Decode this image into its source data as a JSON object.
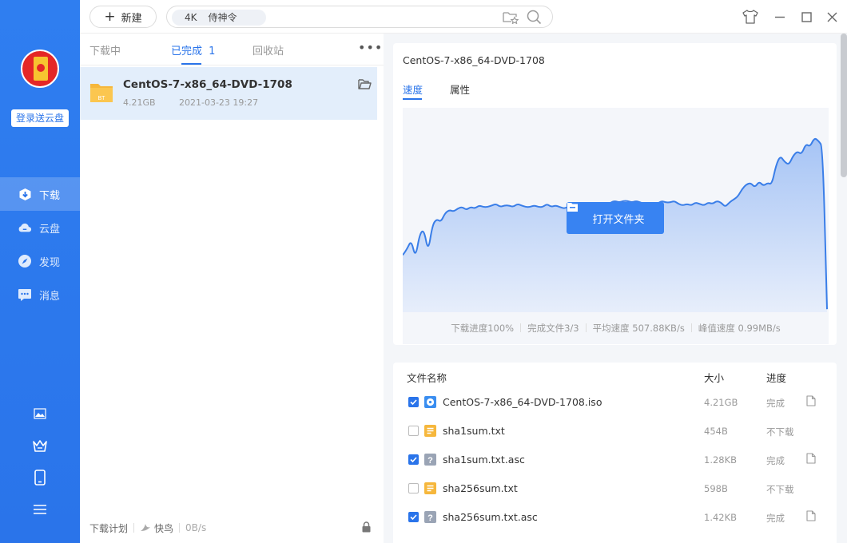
{
  "sidebar": {
    "login_label": "登录送云盘",
    "nav": [
      {
        "label": "下载",
        "icon": "download-icon",
        "active": true
      },
      {
        "label": "云盘",
        "icon": "cloud-icon",
        "active": false
      },
      {
        "label": "发现",
        "icon": "compass-icon",
        "active": false
      },
      {
        "label": "消息",
        "icon": "message-icon",
        "active": false
      }
    ]
  },
  "toolbar": {
    "new_label": "新建",
    "search_tag_quality": "4K",
    "search_tag_name": "侍神令"
  },
  "tabs": {
    "downloading": "下载中",
    "completed": "已完成",
    "completed_count": "1",
    "recycle": "回收站"
  },
  "task": {
    "name": "CentOS-7-x86_64-DVD-1708",
    "size": "4.21GB",
    "date": "2021-03-23 19:27",
    "folder_badge": "BT"
  },
  "bottom": {
    "plan_label": "下载计划",
    "bird_label": "快鸟",
    "speed": "0B/s"
  },
  "detail": {
    "title": "CentOS-7-x86_64-DVD-1708",
    "tab_speed": "速度",
    "tab_props": "属性",
    "open_folder_label": "打开文件夹",
    "stats": {
      "progress": "下载进度100%",
      "files": "完成文件3/3",
      "avg": "平均速度 507.88KB/s",
      "peak": "峰值速度 0.99MB/s"
    }
  },
  "files": {
    "col_name": "文件名称",
    "col_size": "大小",
    "col_progress": "进度",
    "rows": [
      {
        "name": "CentOS-7-x86_64-DVD-1708.iso",
        "size": "4.21GB",
        "progress": "完成",
        "checked": true,
        "type": "disc"
      },
      {
        "name": "sha1sum.txt",
        "size": "454B",
        "progress": "不下载",
        "checked": false,
        "type": "txt"
      },
      {
        "name": "sha1sum.txt.asc",
        "size": "1.28KB",
        "progress": "完成",
        "checked": true,
        "type": "unknown"
      },
      {
        "name": "sha256sum.txt",
        "size": "598B",
        "progress": "不下载",
        "checked": false,
        "type": "txt"
      },
      {
        "name": "sha256sum.txt.asc",
        "size": "1.42KB",
        "progress": "完成",
        "checked": true,
        "type": "unknown"
      }
    ]
  },
  "chart_data": {
    "type": "area",
    "title": "",
    "xlabel": "",
    "ylabel": "",
    "color": "#3a7ee8",
    "values": [
      0.38,
      0.42,
      0.48,
      0.36,
      0.52,
      0.55,
      0.4,
      0.58,
      0.62,
      0.6,
      0.66,
      0.68,
      0.67,
      0.69,
      0.7,
      0.68,
      0.7,
      0.69,
      0.71,
      0.7,
      0.7,
      0.71,
      0.72,
      0.7,
      0.71,
      0.71,
      0.7,
      0.72,
      0.71,
      0.7,
      0.7,
      0.71,
      0.7,
      0.7,
      0.72,
      0.7,
      0.71,
      0.7,
      0.69,
      0.7,
      0.71,
      0.7,
      0.71,
      0.7,
      0.72,
      0.72,
      0.7,
      0.72,
      0.7,
      0.73,
      0.74,
      0.73,
      0.74,
      0.74,
      0.73,
      0.74,
      0.73,
      0.72,
      0.72,
      0.71,
      0.72,
      0.74,
      0.73,
      0.73,
      0.74,
      0.72,
      0.71,
      0.72,
      0.71,
      0.73,
      0.72,
      0.71,
      0.73,
      0.72,
      0.74,
      0.73,
      0.7,
      0.73,
      0.75,
      0.77,
      0.82,
      0.85,
      0.86,
      0.83,
      0.87,
      0.84,
      0.86,
      0.85,
      0.98,
      1.04,
      1.0,
      0.98,
      1.04,
      1.07,
      1.05,
      1.12,
      1.1,
      1.16,
      1.14,
      1.1,
      0.02
    ]
  }
}
